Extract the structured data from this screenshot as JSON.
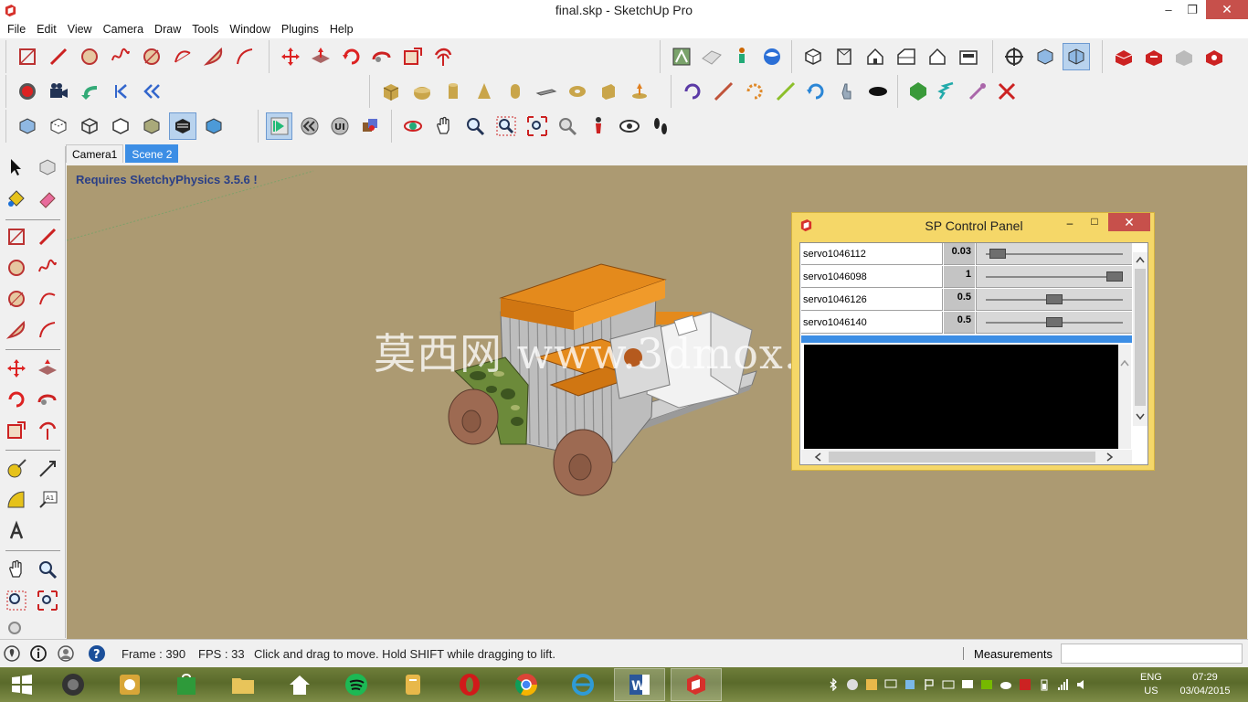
{
  "window": {
    "title": "final.skp - SketchUp Pro",
    "minimize": "–",
    "restore": "❐",
    "close": "✕"
  },
  "menu": [
    "File",
    "Edit",
    "View",
    "Camera",
    "Draw",
    "Tools",
    "Window",
    "Plugins",
    "Help"
  ],
  "scenes": {
    "tabs": [
      "Camera1",
      "Scene 2"
    ],
    "active": "Scene 2"
  },
  "viewport": {
    "note": "Requires SketchyPhysics 3.5.6 !",
    "watermark": "莫西网 www.3dmox.com",
    "background": "#ac9a72"
  },
  "sp_panel": {
    "title": "SP Control Panel",
    "minimize": "–",
    "maximize": "□",
    "close": "✕",
    "rows": [
      {
        "name": "servo1046112",
        "value": "0.03",
        "level": 0.03
      },
      {
        "name": "servo1046098",
        "value": "1",
        "level": 1
      },
      {
        "name": "servo1046126",
        "value": "0.5",
        "level": 0.5
      },
      {
        "name": "servo1046140",
        "value": "0.5",
        "level": 0.5
      }
    ]
  },
  "status": {
    "frame": "Frame : 390",
    "fps": "FPS : 33",
    "hint": "Click and drag to move. Hold SHIFT while dragging to lift.",
    "measurements_label": "Measurements",
    "measurements_value": ""
  },
  "taskbar": {
    "lang_line1": "ENG",
    "lang_line2": "US",
    "time": "07:29",
    "date": "03/04/2015"
  },
  "colors": {
    "accent": "#3c8ee5",
    "close_red": "#c7504b",
    "panel_yellow": "#f5d768",
    "taskbar": "#5a6a2b"
  }
}
